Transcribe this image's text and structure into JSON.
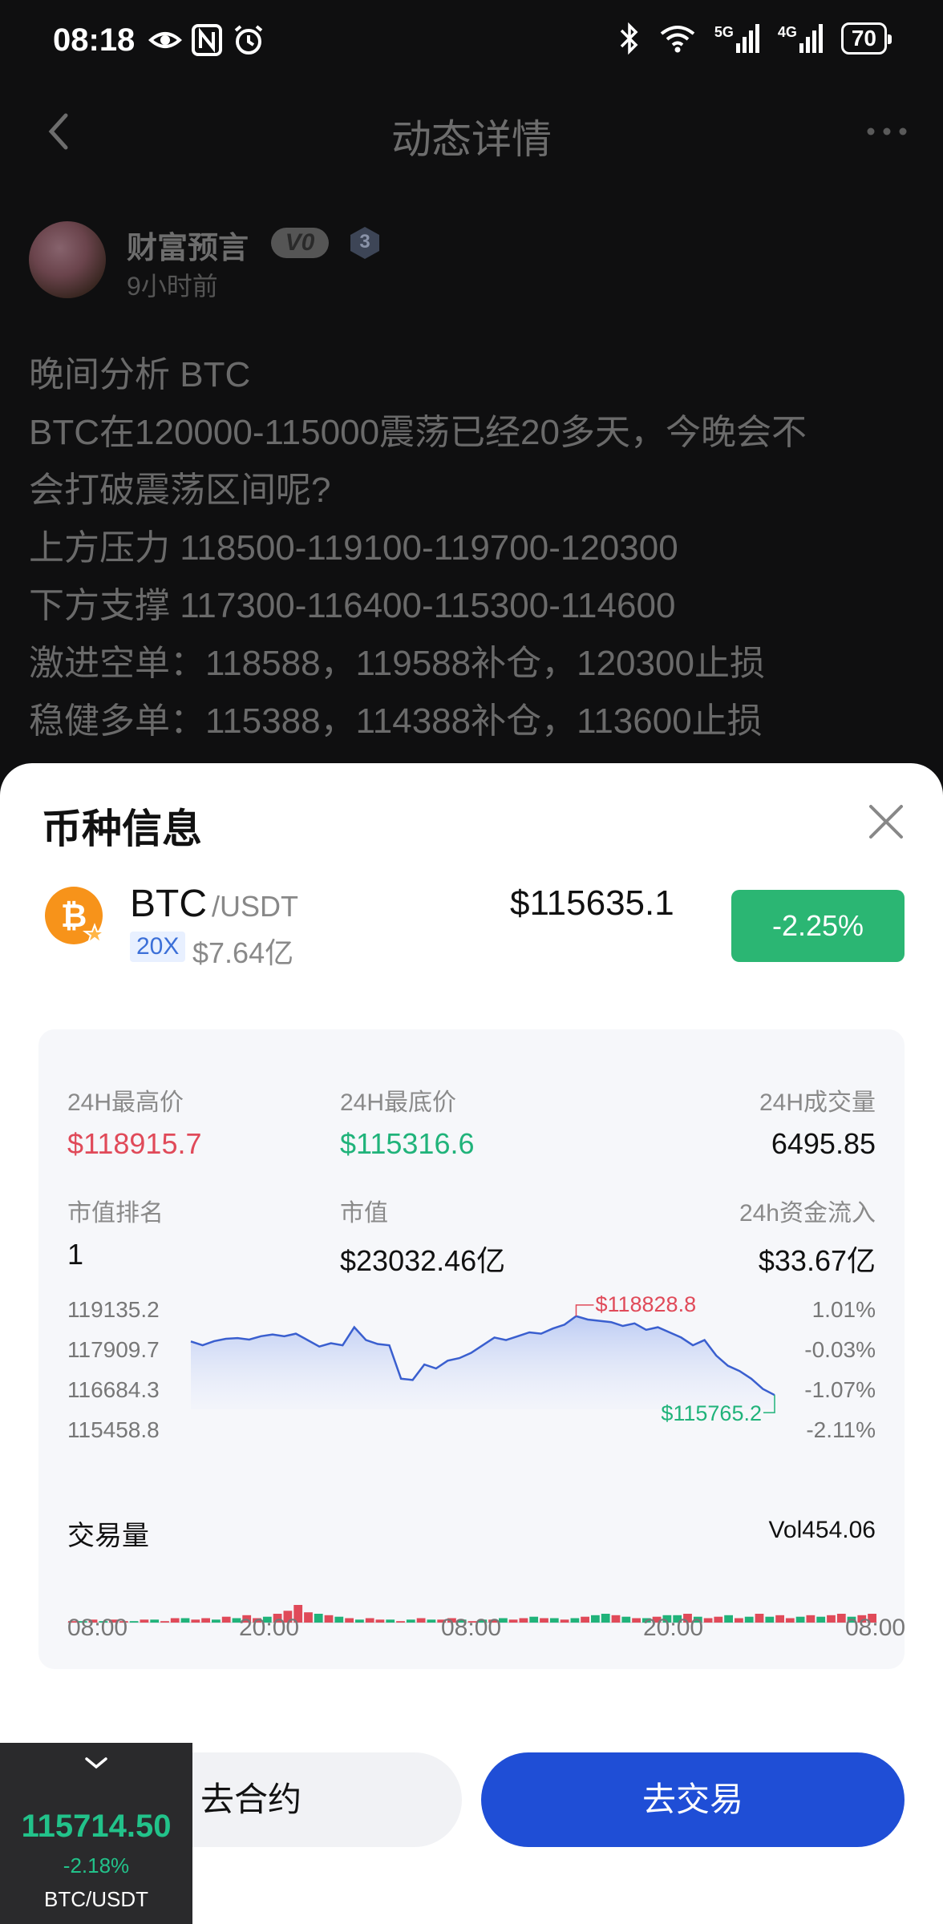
{
  "status_bar": {
    "time": "08:18",
    "signal_5g": "5G",
    "signal_4g": "4G",
    "battery": "70"
  },
  "nav": {
    "title": "动态详情"
  },
  "post": {
    "author": "财富预言",
    "vip_label": "V0",
    "level": "3",
    "time": "9小时前",
    "lines": [
      "晚间分析 BTC",
      "BTC在120000-115000震荡已经20多天，今晚会不",
      "会打破震荡区间呢?",
      "上方压力 118500-119100-119700-120300",
      "下方支撑 117300-116400-115300-114600",
      "激进空单：118588，119588补仓，120300止损",
      "稳健多单：115388，114388补仓，113600止损"
    ]
  },
  "sheet": {
    "title": "币种信息",
    "coin": {
      "symbol": "BTC",
      "quote": "/USDT",
      "leverage": "20X",
      "market_cap_short": "$7.64亿",
      "price": "$115635.1",
      "change": "-2.25%"
    },
    "stats": {
      "high_label": "24H最高价",
      "high_value": "$118915.7",
      "low_label": "24H最底价",
      "low_value": "$115316.6",
      "volume_label": "24H成交量",
      "volume_value": "6495.85",
      "rank_label": "市值排名",
      "rank_value": "1",
      "mcap_label": "市值",
      "mcap_value": "$23032.46亿",
      "inflow_label": "24h资金流入",
      "inflow_value": "$33.67亿"
    },
    "volume": {
      "title": "交易量",
      "value": "Vol454.06"
    },
    "buttons": {
      "contract": "去合约",
      "trade": "去交易"
    }
  },
  "ticker": {
    "price": "115714.50",
    "change": "-2.18%",
    "pair": "BTC/USDT"
  },
  "colors": {
    "up": "#e04a59",
    "down": "#20b37a",
    "accent": "#1f4ed6",
    "line": "#3a5fcf"
  },
  "chart_data": {
    "type": "area",
    "title": "",
    "y_ticks": [
      "119135.2",
      "117909.7",
      "116684.3",
      "115458.8"
    ],
    "y_right_ticks": [
      "1.01%",
      "-0.03%",
      "-1.07%",
      "-2.11%"
    ],
    "x_ticks": [
      "08:00",
      "20:00",
      "08:00",
      "20:00",
      "08:00"
    ],
    "ylim": [
      115458.8,
      119135.2
    ],
    "high_label": "$118828.8",
    "low_label": "$115765.2",
    "series": [
      {
        "values": [
          117850,
          117700,
          117860,
          117950,
          117980,
          117920,
          118050,
          118120,
          118050,
          118150,
          117900,
          117650,
          117780,
          117700,
          118400,
          117900,
          117750,
          117700,
          116400,
          116350,
          116950,
          116800,
          117100,
          117200,
          117400,
          117700,
          118000,
          117900,
          118050,
          118200,
          118150,
          118350,
          118500,
          118828.8,
          118700,
          118650,
          118600,
          118450,
          118550,
          118300,
          118400,
          118200,
          118000,
          117700,
          117900,
          117300,
          116900,
          116700,
          116400,
          116000,
          115765.2
        ]
      }
    ],
    "volume": {
      "values": [
        1,
        1,
        2,
        1,
        2,
        1,
        1,
        2,
        2,
        1,
        3,
        3,
        2,
        3,
        2,
        4,
        3,
        5,
        3,
        4,
        6,
        8,
        12,
        7,
        6,
        5,
        4,
        3,
        2,
        3,
        2,
        2,
        1,
        2,
        3,
        2,
        2,
        3,
        2,
        1,
        2,
        2,
        3,
        2,
        3,
        4,
        3,
        3,
        2,
        3,
        4,
        5,
        6,
        5,
        4,
        3,
        3,
        4,
        5,
        5,
        6,
        4,
        3,
        4,
        5,
        3,
        4,
        6,
        4,
        5,
        3,
        4,
        5,
        4,
        5,
        6,
        4,
        5,
        6
      ],
      "up": [
        1,
        0,
        1,
        0,
        1,
        1,
        0,
        1,
        0,
        1,
        1,
        0,
        1,
        1,
        0,
        1,
        0,
        1,
        1,
        0,
        1,
        1,
        1,
        1,
        0,
        1,
        0,
        1,
        0,
        1,
        1,
        0,
        1,
        0,
        1,
        0,
        1,
        1,
        0,
        1,
        0,
        1,
        0,
        1,
        1,
        0,
        1,
        0,
        1,
        0,
        1,
        0,
        0,
        1,
        0,
        1,
        0,
        1,
        0,
        0,
        1,
        0,
        1,
        1,
        0,
        1,
        0,
        1,
        0,
        1,
        1,
        0,
        1,
        0,
        1,
        1,
        0,
        1,
        1
      ]
    }
  }
}
